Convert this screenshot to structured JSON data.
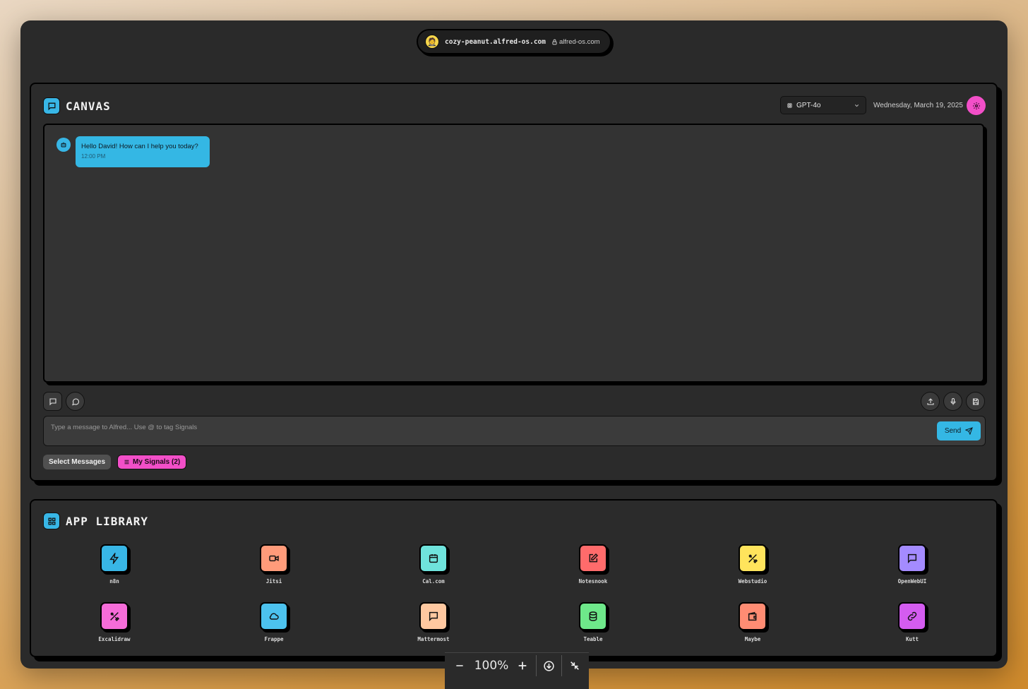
{
  "urlbar": {
    "avatar_emoji": "🤵",
    "host": "cozy-peanut.alfred-os.com",
    "domain": "alfred-os.com"
  },
  "canvas": {
    "title": "CANVAS",
    "model": "GPT-4o",
    "date": "Wednesday, March 19, 2025",
    "messages": [
      {
        "text": "Hello David! How can I help you today?",
        "time": "12:00 PM"
      }
    ],
    "input_placeholder": "Type a message to Alfred... Use @ to tag Signals",
    "send_label": "Send",
    "select_messages_label": "Select Messages",
    "signals_label": "My Signals (2)"
  },
  "library": {
    "title": "APP LIBRARY",
    "apps": [
      {
        "name": "n8n",
        "color": "#38b6e6",
        "icon": "lightning-icon"
      },
      {
        "name": "Jitsi",
        "color": "#ff9b7a",
        "icon": "video-icon"
      },
      {
        "name": "Cal.com",
        "color": "#6fe3dc",
        "icon": "calendar-icon"
      },
      {
        "name": "Notesnook",
        "color": "#ff6b6b",
        "icon": "edit-icon"
      },
      {
        "name": "Webstudio",
        "color": "#ffe45c",
        "icon": "design-icon"
      },
      {
        "name": "OpenWebUI",
        "color": "#a48bff",
        "icon": "chat-icon"
      },
      {
        "name": "Excalidraw",
        "color": "#f56cd8",
        "icon": "design-icon"
      },
      {
        "name": "Frappe",
        "color": "#4cc2ee",
        "icon": "cloud-icon"
      },
      {
        "name": "Mattermost",
        "color": "#ffc8a0",
        "icon": "chat-icon"
      },
      {
        "name": "Teable",
        "color": "#6ee88a",
        "icon": "database-icon"
      },
      {
        "name": "Maybe",
        "color": "#ff8c73",
        "icon": "wallet-icon"
      },
      {
        "name": "Kutt",
        "color": "#d45cf0",
        "icon": "link-icon"
      }
    ]
  },
  "zoom": {
    "level": "100%"
  }
}
